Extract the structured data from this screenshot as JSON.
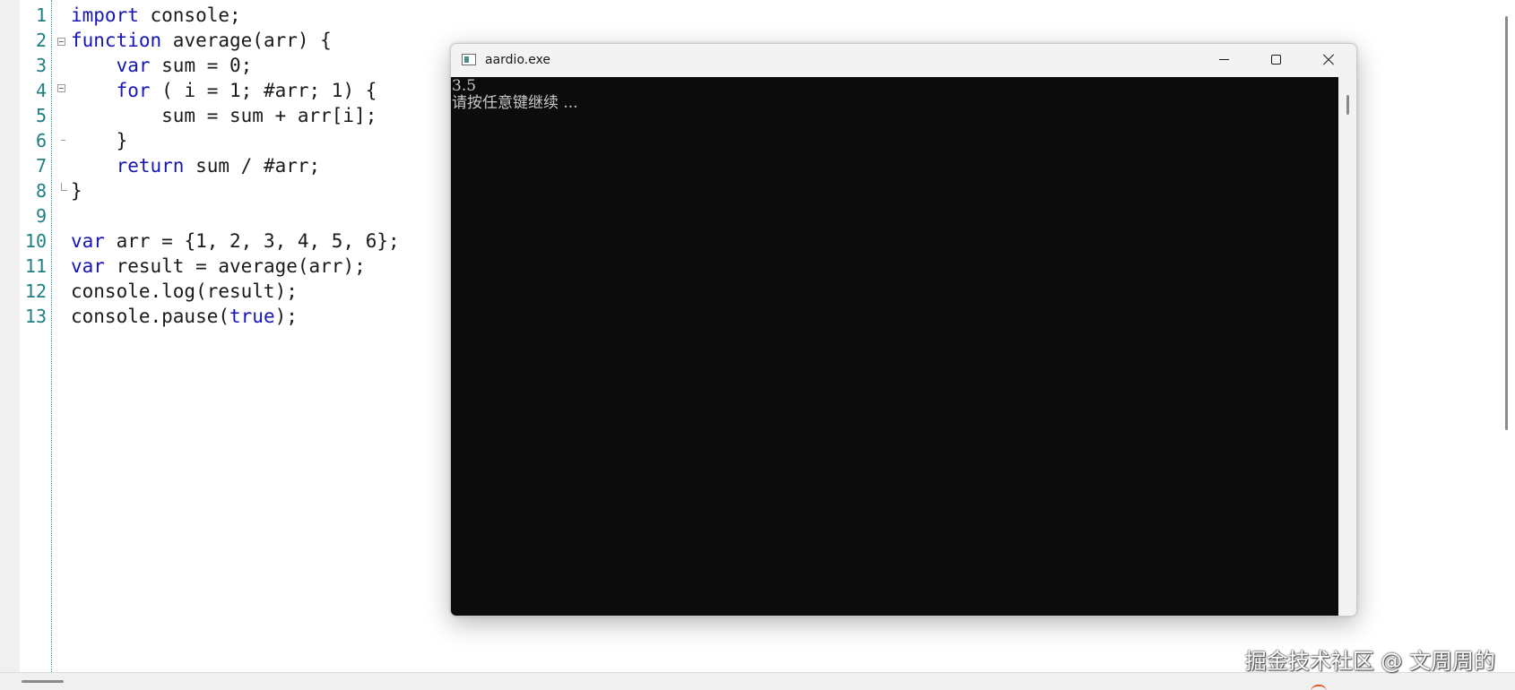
{
  "editor": {
    "line_numbers": [
      "1",
      "2",
      "3",
      "4",
      "5",
      "6",
      "7",
      "8",
      "9",
      "10",
      "11",
      "12",
      "13"
    ],
    "lines": [
      [
        {
          "t": "import",
          "k": true
        },
        {
          "t": " console;",
          "k": false
        }
      ],
      [
        {
          "t": "function",
          "k": true
        },
        {
          "t": " average(arr) {",
          "k": false
        }
      ],
      [
        {
          "t": "    ",
          "k": false
        },
        {
          "t": "var",
          "k": true
        },
        {
          "t": " sum = 0;",
          "k": false
        }
      ],
      [
        {
          "t": "    ",
          "k": false
        },
        {
          "t": "for",
          "k": true
        },
        {
          "t": " ( i = 1; #arr; 1) {",
          "k": false
        }
      ],
      [
        {
          "t": "        sum = sum + arr[i];",
          "k": false
        }
      ],
      [
        {
          "t": "    }",
          "k": false
        }
      ],
      [
        {
          "t": "    ",
          "k": false
        },
        {
          "t": "return",
          "k": true
        },
        {
          "t": " sum / #arr;",
          "k": false
        }
      ],
      [
        {
          "t": "}",
          "k": false
        }
      ],
      [],
      [
        {
          "t": "var",
          "k": true
        },
        {
          "t": " arr = {1, 2, 3, 4, 5, 6};",
          "k": false
        }
      ],
      [
        {
          "t": "var",
          "k": true
        },
        {
          "t": " result = average(arr);",
          "k": false
        }
      ],
      [
        {
          "t": "console.log(result);",
          "k": false
        }
      ],
      [
        {
          "t": "console.pause(",
          "k": false
        },
        {
          "t": "true",
          "k": true
        },
        {
          "t": ");",
          "k": false
        }
      ]
    ]
  },
  "console_window": {
    "title": "aardio.exe",
    "output_lines": [
      "3.5",
      "请按任意键继续 ..."
    ],
    "icons": {
      "app": "console-app-icon",
      "minimize": "minimize-icon",
      "maximize": "maximize-icon",
      "close": "close-icon"
    }
  },
  "watermark": "掘金技术社区 @ 文周周的",
  "colors": {
    "keyword": "#1515b8",
    "line_number": "#1d7f82",
    "console_background": "#0c0c0c",
    "console_text": "#c7c7c7"
  }
}
